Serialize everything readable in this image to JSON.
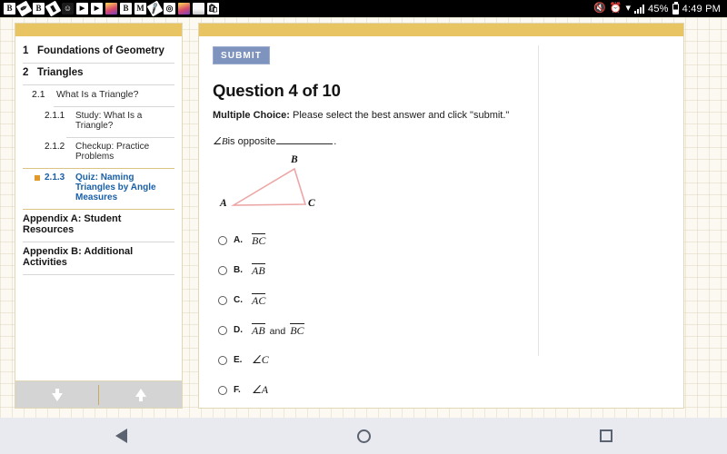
{
  "statusbar": {
    "notification_icons": [
      "blackboard-icon",
      "pencil-icon",
      "blackboard-icon",
      "eraser-icon",
      "snapchat-icon",
      "youtube-icon",
      "youtube-icon",
      "photos-icon",
      "blackboard-icon",
      "gmail-icon",
      "microphone-icon",
      "instagram-icon",
      "gradient-app-icon",
      "gallery-icon",
      "shopping-bag-icon"
    ],
    "mute_icon": "mute-icon",
    "alarm_icon": "alarm-icon",
    "wifi_icon": "wifi-icon",
    "signal_icon": "signal-bars-icon",
    "battery_percent": "45%",
    "battery_icon": "battery-icon",
    "clock": "4:49 PM"
  },
  "sidebar": {
    "items": [
      {
        "num": "1",
        "label": "Foundations of Geometry",
        "level": 1,
        "active": false
      },
      {
        "num": "2",
        "label": "Triangles",
        "level": 1,
        "active": false
      },
      {
        "num": "2.1",
        "label": "What Is a Triangle?",
        "level": 2,
        "active": false
      },
      {
        "num": "2.1.1",
        "label": "Study: What Is a Triangle?",
        "level": 3,
        "active": false
      },
      {
        "num": "2.1.2",
        "label": "Checkup: Practice Problems",
        "level": 3,
        "active": false
      },
      {
        "num": "2.1.3",
        "label": "Quiz: Naming Triangles by Angle Measures",
        "level": 3,
        "active": true
      }
    ],
    "appendices": [
      {
        "label": "Appendix A: Student Resources"
      },
      {
        "label": "Appendix B: Additional Activities"
      }
    ],
    "footer": {
      "scroll_down_icon": "arrow-down-icon",
      "scroll_up_icon": "arrow-up-icon"
    },
    "active_bullet_color": "#e09a2b",
    "active_text_color": "#1a5fa8"
  },
  "content": {
    "submit_label": "SUBMIT",
    "question_title": "Question 4 of 10",
    "instructions_prefix": "Multiple Choice:",
    "instructions_text": " Please select the best answer and click \"submit.\"",
    "stem_angle": "∠B",
    "stem_text_before": " is opposite",
    "stem_text_after": ".",
    "figure": {
      "vertex_a": "A",
      "vertex_b": "B",
      "vertex_c": "C",
      "stroke_color": "#eda6a6"
    },
    "options": [
      {
        "letter": "A.",
        "kind": "segment",
        "text": "BC"
      },
      {
        "letter": "B.",
        "kind": "segment",
        "text": "AB"
      },
      {
        "letter": "C.",
        "kind": "segment",
        "text": "AC"
      },
      {
        "letter": "D.",
        "kind": "segment_pair",
        "text": "AB",
        "conj": "and",
        "text2": "BC"
      },
      {
        "letter": "E.",
        "kind": "angle",
        "text": "∠C"
      },
      {
        "letter": "F.",
        "kind": "angle",
        "text": "∠A"
      }
    ]
  },
  "navbar": {
    "back_icon": "back-triangle-icon",
    "home_icon": "home-circle-icon",
    "recents_icon": "recents-square-icon"
  }
}
